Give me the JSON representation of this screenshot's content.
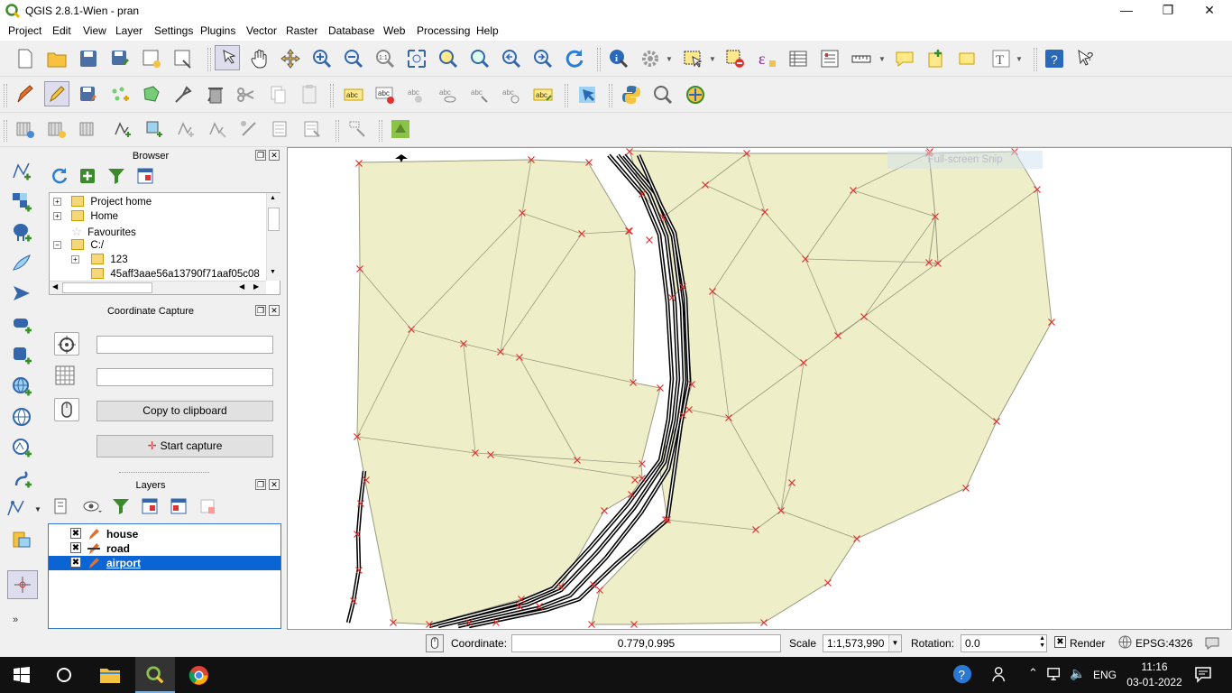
{
  "window": {
    "title": "QGIS 2.8.1-Wien - pran",
    "min": "—",
    "restore": "❐",
    "close": "✕"
  },
  "menu": [
    "Project",
    "Edit",
    "View",
    "Layer",
    "Settings",
    "Plugins",
    "Vector",
    "Raster",
    "Database",
    "Web",
    "Processing",
    "Help"
  ],
  "browser": {
    "title": "Browser",
    "items": [
      {
        "label": "Project home",
        "icon": "folder-icon",
        "expander": "+"
      },
      {
        "label": "Home",
        "icon": "folder-icon",
        "expander": "+"
      },
      {
        "label": "Favourites",
        "icon": "star-icon",
        "expander": ""
      },
      {
        "label": "C:/",
        "icon": "folder-icon",
        "expander": "−"
      },
      {
        "label": "123",
        "icon": "folder-icon",
        "expander": "+"
      },
      {
        "label": "45aff3aae56a13790f71aaf05c08",
        "icon": "folder-icon",
        "expander": ""
      }
    ]
  },
  "coordinate_capture": {
    "title": "Coordinate Capture",
    "field1": "",
    "field2": "",
    "copy_label": "Copy to clipboard",
    "start_label": "Start capture"
  },
  "layers": {
    "title": "Layers",
    "items": [
      {
        "name": "house",
        "checked": "✖",
        "selected": false
      },
      {
        "name": "road",
        "checked": "✖",
        "selected": false
      },
      {
        "name": "airport",
        "checked": "✖",
        "selected": true
      }
    ]
  },
  "map": {
    "overlay_text": "Full-screen Snip",
    "bg": "#ffffff",
    "polygon_fill": "#eeeec8",
    "polygon_stroke": "#9a9a80",
    "vertex_color": "#e03030"
  },
  "status": {
    "coordinate_label": "Coordinate:",
    "coordinate_value": "0.779,0.995",
    "scale_label": "Scale",
    "scale_value": "1:1,573,990",
    "rotation_label": "Rotation:",
    "rotation_value": "0.0",
    "render_label": "Render",
    "render_check": "✖",
    "crs": "EPSG:4326"
  },
  "taskbar": {
    "lang": "ENG",
    "time": "11:16",
    "date": "03-01-2022"
  }
}
